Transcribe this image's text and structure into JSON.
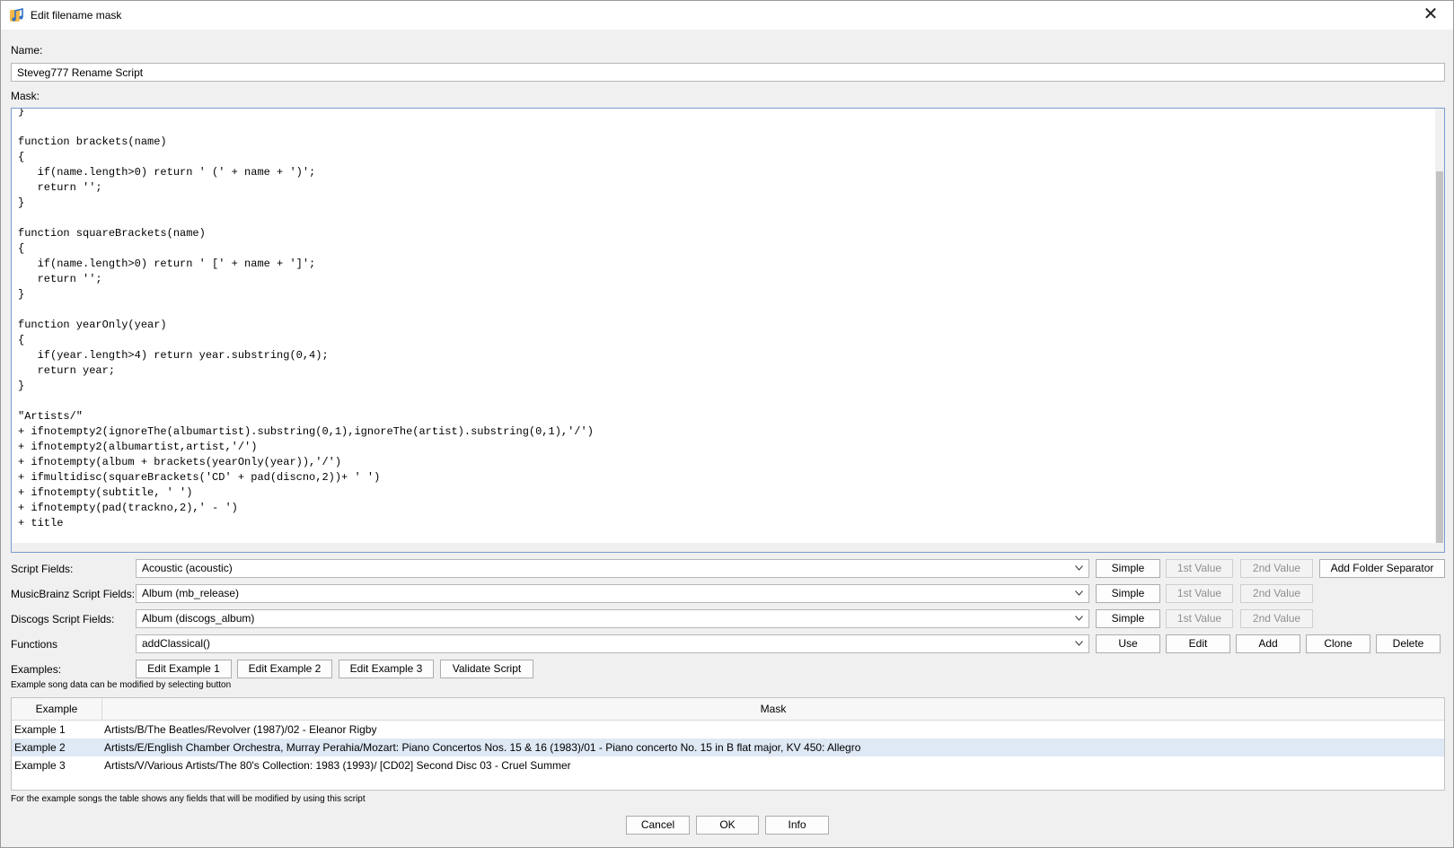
{
  "window": {
    "title": "Edit filename mask",
    "icon": "music-note-icon"
  },
  "name_label": "Name:",
  "name_value": "Steveg777 Rename Script",
  "mask_label": "Mask:",
  "mask_code": "}\n\nfunction brackets(name)\n{\n   if(name.length>0) return ' (' + name + ')';\n   return '';\n}\n\nfunction squareBrackets(name)\n{\n   if(name.length>0) return ' [' + name + ']';\n   return '';\n}\n\nfunction yearOnly(year)\n{\n   if(year.length>4) return year.substring(0,4);\n   return year;\n}\n\n\"Artists/\"\n+ ifnotempty2(ignoreThe(albumartist).substring(0,1),ignoreThe(artist).substring(0,1),'/')\n+ ifnotempty2(albumartist,artist,'/')\n+ ifnotempty(album + brackets(yearOnly(year)),'/')\n+ ifmultidisc(squareBrackets('CD' + pad(discno,2))+ ' ')\n+ ifnotempty(subtitle, ' ')\n+ ifnotempty(pad(trackno,2),' - ')\n+ title",
  "script_fields": {
    "label": "Script Fields:",
    "value": "Acoustic (acoustic)"
  },
  "mb_fields": {
    "label": "MusicBrainz Script Fields:",
    "value": "Album (mb_release)"
  },
  "discogs_fields": {
    "label": "Discogs Script Fields:",
    "value": "Album (discogs_album)"
  },
  "functions": {
    "label": "Functions",
    "value": "addClassical()"
  },
  "buttons": {
    "simple": "Simple",
    "first_value": "1st Value",
    "second_value": "2nd Value",
    "add_folder_separator": "Add Folder Separator",
    "use": "Use",
    "edit": "Edit",
    "add": "Add",
    "clone": "Clone",
    "delete": "Delete",
    "edit_example_1": "Edit Example 1",
    "edit_example_2": "Edit Example 2",
    "edit_example_3": "Edit Example 3",
    "validate_script": "Validate Script",
    "cancel": "Cancel",
    "ok": "OK",
    "info": "Info"
  },
  "examples_label": "Examples:",
  "examples_hint": "Example song data can be modified by selecting button",
  "table": {
    "headers": [
      "Example",
      "Mask"
    ],
    "rows": [
      {
        "example": "Example 1",
        "mask": "Artists/B/The Beatles/Revolver (1987)/02 - Eleanor Rigby"
      },
      {
        "example": "Example 2",
        "mask": "Artists/E/English Chamber Orchestra, Murray Perahia/Mozart: Piano Concertos Nos. 15 & 16 (1983)/01 - Piano concerto No. 15 in B flat major, KV 450: Allegro"
      },
      {
        "example": "Example 3",
        "mask": "Artists/V/Various Artists/The 80's Collection: 1983 (1993)/ [CD02] Second Disc 03 - Cruel Summer"
      }
    ],
    "selected_row": 1
  },
  "table_hint": "For the example songs the table shows any fields that will be modified by using this script",
  "colors": {
    "selection": "#dfe8f5",
    "focus_border": "#7a9cd0"
  }
}
